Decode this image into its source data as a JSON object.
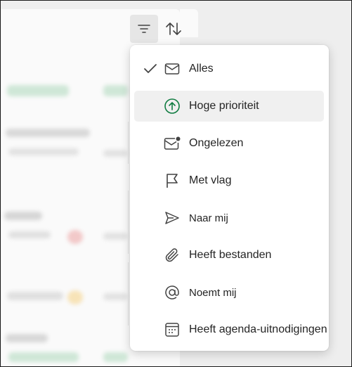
{
  "filter_menu": {
    "items": [
      {
        "label": "Alles",
        "icon": "mail-icon",
        "checked": true
      },
      {
        "label": "Hoge prioriteit",
        "icon": "arrow-up-circle-icon"
      },
      {
        "label": "Ongelezen",
        "icon": "mail-unread-icon"
      },
      {
        "label": "Met vlag",
        "icon": "flag-icon"
      },
      {
        "label": "Naar mij",
        "icon": "send-icon"
      },
      {
        "label": "Heeft bestanden",
        "icon": "paperclip-icon"
      },
      {
        "label": "Noemt mij",
        "icon": "at-icon"
      },
      {
        "label": "Heeft agenda-uitnodigingen",
        "icon": "calendar-icon"
      }
    ]
  },
  "colors": {
    "accent_green": "#107c41",
    "menu_bg": "#ffffff",
    "hover_bg": "#f0f0f0"
  }
}
